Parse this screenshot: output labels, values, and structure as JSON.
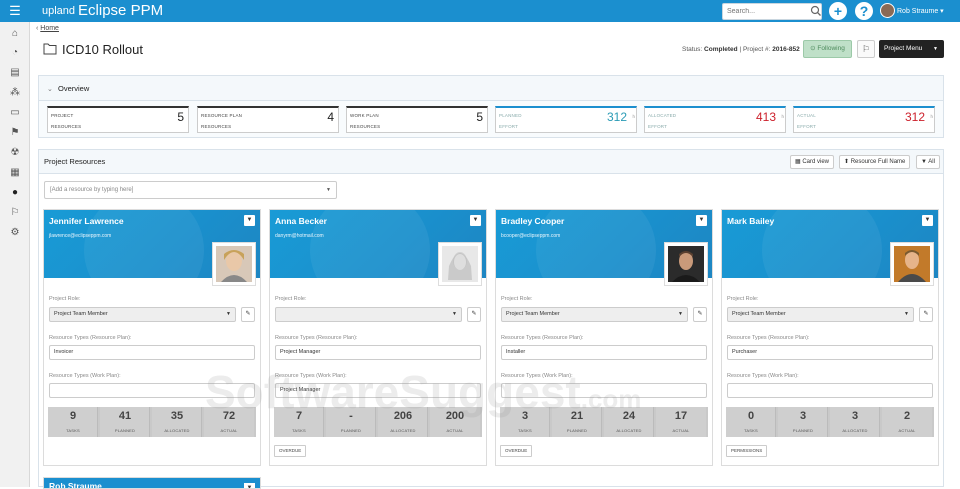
{
  "app": {
    "brand_upland": "upland",
    "brand_name": "Eclipse PPM"
  },
  "topbar": {
    "search_placeholder": "Search...",
    "add_label": "+",
    "help_label": "?",
    "user_name": "Rob Straume ▾"
  },
  "sidebar": {
    "icons": [
      "home-icon",
      "dashboard-icon",
      "documents-icon",
      "portfolio-icon",
      "folder-icon",
      "flag-icon",
      "radiation-icon",
      "calendar-icon",
      "person-icon",
      "settings-flag-icon",
      "gear-icon"
    ]
  },
  "breadcrumb": {
    "home": "Home"
  },
  "project": {
    "title": "ICD10 Rollout",
    "status_label": "Status:",
    "status_value": "Completed",
    "number_label": "Project #:",
    "number_value": "2016-852",
    "following_label": "Following",
    "menu_label": "Project Menu"
  },
  "overview": {
    "title": "Overview",
    "metrics": [
      {
        "l1": "PROJECT",
        "l2": "RESOURCES",
        "value": "5",
        "hr": ""
      },
      {
        "l1": "RESOURCE PLAN",
        "l2": "RESOURCES",
        "value": "4",
        "hr": ""
      },
      {
        "l1": "WORK PLAN",
        "l2": "RESOURCES",
        "value": "5",
        "hr": ""
      },
      {
        "l1": "PLANNED",
        "l2": "EFFORT",
        "value": "312",
        "hr": "h"
      },
      {
        "l1": "ALLOCATED",
        "l2": "EFFORT",
        "value": "413",
        "hr": "h"
      },
      {
        "l1": "ACTUAL",
        "l2": "EFFORT",
        "value": "312",
        "hr": "h"
      }
    ]
  },
  "resources": {
    "title": "Project Resources",
    "card_view": "Card view",
    "sort_label": "Resource Full Name",
    "filter_label": "All",
    "add_placeholder": "[Add a resource by typing here]",
    "labels": {
      "project_role": "Project Role:",
      "rt_resource_plan": "Resource Types (Resource Plan):",
      "rt_work_plan": "Resource Types (Work Plan):",
      "tasks": "TASKS",
      "planned": "PLANNED",
      "allocated": "ALLOCATED",
      "actual": "ACTUAL"
    },
    "cards": [
      {
        "name": "Jennifer Lawrence",
        "email": "jlawrence@eclipseppm.com",
        "role": "Project Team Member",
        "rt_plan": "Invoicer",
        "rt_work": "",
        "tasks": "9",
        "planned": "41",
        "allocated": "35",
        "actual": "72",
        "tag": ""
      },
      {
        "name": "Anna Becker",
        "email": "danyrm@hotmail.com",
        "role": "",
        "rt_plan": "Project Manager",
        "rt_work": "Project Manager",
        "tasks": "7",
        "planned": "-",
        "allocated": "206",
        "actual": "200",
        "tag": "OVERDUE"
      },
      {
        "name": "Bradley Cooper",
        "email": "bcooper@eclipseppm.com",
        "role": "Project Team Member",
        "rt_plan": "Installer",
        "rt_work": "",
        "tasks": "3",
        "planned": "21",
        "allocated": "24",
        "actual": "17",
        "tag": "OVERDUE"
      },
      {
        "name": "Mark Bailey",
        "email": "",
        "role": "Project Team Member",
        "rt_plan": "Purchaser",
        "rt_work": "",
        "tasks": "0",
        "planned": "3",
        "allocated": "3",
        "actual": "2",
        "tag": "PERMISSIONS"
      }
    ],
    "partial_card": {
      "name": "Rob Straume"
    }
  },
  "watermark": {
    "main": "SoftwareSuggest",
    "suffix": ".com"
  }
}
